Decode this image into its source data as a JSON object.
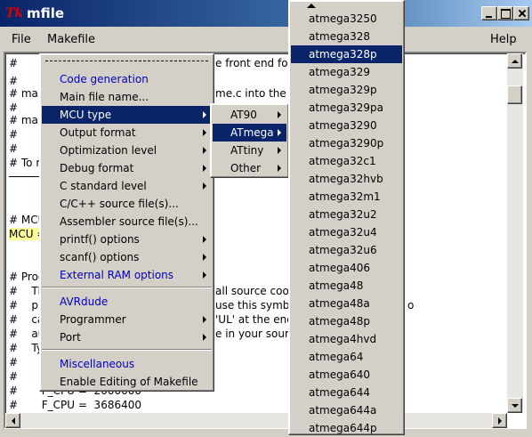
{
  "window": {
    "icon_text": "Tk",
    "title": "mfile"
  },
  "menubar": {
    "file": "File",
    "makefile": "Makefile",
    "help": "Help"
  },
  "editor": {
    "lines": [
      "#",
      "#",
      "# mak",
      "#",
      "# mak",
      "#",
      "#",
      "# To re",
      "# MCU",
      "MCU =",
      "# Proc",
      "#    Th",
      "#    pro",
      "#    ca",
      "#    au",
      "#    Ty",
      "#       F",
      "#       F",
      "#       F_CPU =  2000000",
      "#       F_CPU =  3686400"
    ],
    "fragments": [
      "e front end for c",
      "me.c into the a",
      "all source coo",
      "use this symbo",
      "'UL' at the end",
      "e in your sourc",
      "o"
    ]
  },
  "makefile_menu": {
    "items": [
      {
        "label": "Code generation",
        "style": "blue",
        "sub": false
      },
      {
        "label": "Main file name...",
        "style": "normal",
        "sub": false
      },
      {
        "label": "MCU type",
        "style": "active",
        "sub": true
      },
      {
        "label": "Output format",
        "style": "normal",
        "sub": true
      },
      {
        "label": "Optimization level",
        "style": "normal",
        "sub": true
      },
      {
        "label": "Debug format",
        "style": "normal",
        "sub": true
      },
      {
        "label": "C standard level",
        "style": "normal",
        "sub": true
      },
      {
        "label": "C/C++ source file(s)...",
        "style": "normal",
        "sub": false
      },
      {
        "label": "Assembler source file(s)...",
        "style": "normal",
        "sub": false
      },
      {
        "label": "printf() options",
        "style": "normal",
        "sub": true
      },
      {
        "label": "scanf() options",
        "style": "normal",
        "sub": true
      },
      {
        "label": "External RAM options",
        "style": "blue",
        "sub": true
      },
      {
        "label": "AVRdude",
        "style": "blue",
        "sub": false
      },
      {
        "label": "Programmer",
        "style": "normal",
        "sub": true
      },
      {
        "label": "Port",
        "style": "normal",
        "sub": true
      },
      {
        "label": "Miscellaneous",
        "style": "blue",
        "sub": false
      },
      {
        "label": "Enable Editing of Makefile",
        "style": "normal",
        "sub": false
      }
    ]
  },
  "mcu_type_menu": {
    "items": [
      {
        "label": "AT90",
        "active": false
      },
      {
        "label": "ATmega",
        "active": true
      },
      {
        "label": "ATtiny",
        "active": false
      },
      {
        "label": "Other",
        "active": false
      }
    ]
  },
  "atmega_menu": {
    "items": [
      "atmega3250",
      "atmega328",
      "atmega328p",
      "atmega329",
      "atmega329p",
      "atmega329pa",
      "atmega3290",
      "atmega3290p",
      "atmega32c1",
      "atmega32hvb",
      "atmega32m1",
      "atmega32u2",
      "atmega32u4",
      "atmega32u6",
      "atmega406",
      "atmega48",
      "atmega48a",
      "atmega48p",
      "atmega4hvd",
      "atmega64",
      "atmega640",
      "atmega644",
      "atmega644a",
      "atmega644p"
    ],
    "selected": "atmega328p"
  }
}
